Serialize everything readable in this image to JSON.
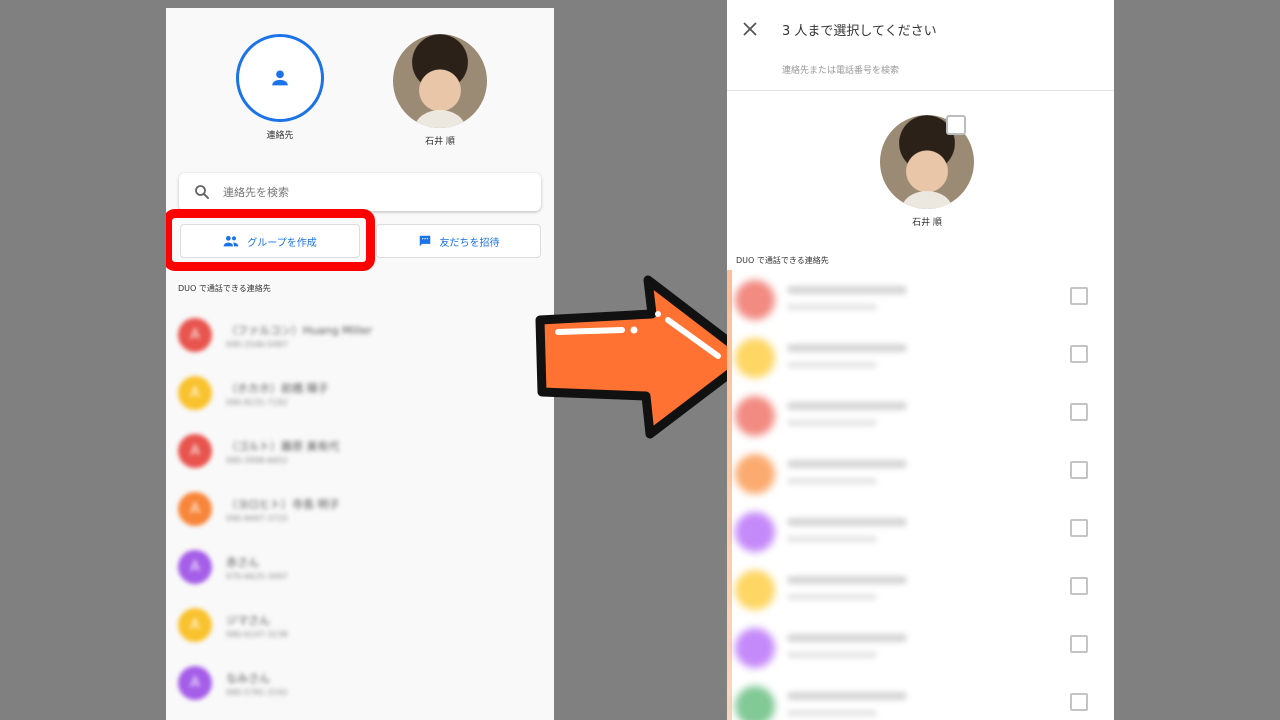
{
  "left_screen": {
    "contacts_button_label": "連絡先",
    "top_person_name": "石井 順",
    "search_placeholder": "連絡先を検索",
    "create_group_label": "グループを作成",
    "invite_friends_label": "友だちを招待",
    "section_title": "DUO で通話できる連絡先",
    "contacts": [
      {
        "initial": "A",
        "color": "#e8544e",
        "name": "（ファルコン）Huang Miller",
        "phone": "090-2546-0487"
      },
      {
        "initial": "A",
        "color": "#f9c22e",
        "name": "（ホカホ）前橋 陽子",
        "phone": "090-8231-7192"
      },
      {
        "initial": "A",
        "color": "#e8544e",
        "name": "（ゴルト）藤原 美有代",
        "phone": "080-3998-6652"
      },
      {
        "initial": "A",
        "color": "#f7863a",
        "name": "（ヨロヒト）寺島 明子",
        "phone": "090-8497-3725"
      },
      {
        "initial": "A",
        "color": "#a55ee8",
        "name": "赤さん",
        "phone": "070-6625-3097"
      },
      {
        "initial": "A",
        "color": "#f9c22e",
        "name": "ジマさん",
        "phone": "080-6147-3238"
      },
      {
        "initial": "A",
        "color": "#a55ee8",
        "name": "なみさん",
        "phone": "080-5781-3192"
      }
    ]
  },
  "right_screen": {
    "title": "3 人まで選択してください",
    "search_placeholder": "連絡先または電話番号を検索",
    "selected_name": "石井 順",
    "section_title": "DUO で通話できる連絡先",
    "rows": [
      {
        "color": "#f28b82"
      },
      {
        "color": "#fdd663"
      },
      {
        "color": "#f28b82"
      },
      {
        "color": "#fbab70"
      },
      {
        "color": "#c58af9"
      },
      {
        "color": "#fdd663"
      },
      {
        "color": "#c58af9"
      },
      {
        "color": "#81c995"
      }
    ]
  },
  "colors": {
    "accent": "#1a73e8",
    "highlight": "#ff0000",
    "arrow_fill": "#ff7232",
    "background": "#808080"
  }
}
